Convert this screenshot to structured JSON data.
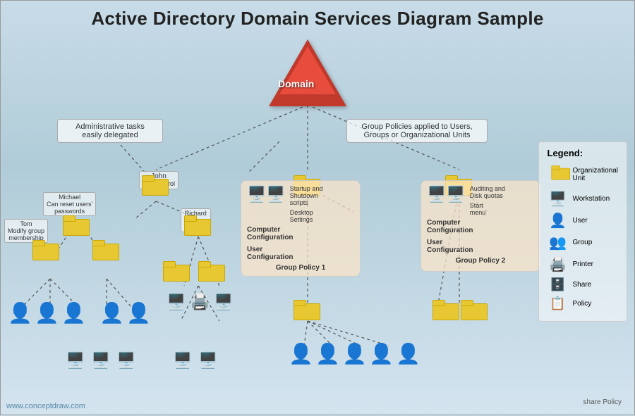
{
  "title": "Active Directory Domain Services Diagram Sample",
  "domain_label": "Domain",
  "annotations": {
    "admin_tasks": "Administrative tasks\neasily delegated",
    "group_policies": "Group Policies applied to Users,\nGroups or Organizational Units"
  },
  "names": {
    "john": "John\nFull Control",
    "michael": "Michael\nCan reset users'\npasswords",
    "tom": "Tom\nModify group\nmembership",
    "richard": "Richard\nManage\nprinters"
  },
  "group_policies": {
    "gp1": {
      "label": "Group Policy 1",
      "startup": "Startup and\nShutdown\nscripts",
      "desktop": "Desktop\nSettings",
      "start": "",
      "computer_config": "Computer\nConfiguration",
      "user_config": "User\nConfiguration"
    },
    "gp2": {
      "label": "Group Policy 2",
      "auditing": "Auditing and\nDisk quotas",
      "start_menu": "Start\nmenu",
      "computer_config": "Computer\nConfiguration",
      "user_config": "User\nConfiguration"
    }
  },
  "legend": {
    "title": "Legend:",
    "items": [
      {
        "icon": "folder",
        "label": "Organizational\nUnit"
      },
      {
        "icon": "workstation",
        "label": "Workstation"
      },
      {
        "icon": "user",
        "label": "User"
      },
      {
        "icon": "group",
        "label": "Group"
      },
      {
        "icon": "printer",
        "label": "Printer"
      },
      {
        "icon": "share",
        "label": "Share"
      },
      {
        "icon": "policy",
        "label": "Policy"
      }
    ]
  },
  "watermark": "www.conceptdraw.com"
}
